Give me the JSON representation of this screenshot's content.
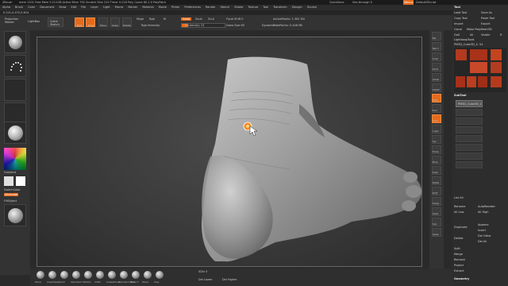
{
  "title_bar": {
    "app": "ZBrush",
    "stats": "mem 1101 Free Mem 5.211GB  Active Mem 792  Scratch Disk 220  Timer 0.018  Poly Count 60.2.0 PolyPaint",
    "quicksave": "QuickSave",
    "see_through": "See-through 0",
    "menus": "Menus",
    "default_zscript": "DefaultZScript"
  },
  "menu_bar": [
    "Alpha",
    "Brush",
    "Color",
    "Document",
    "Draw",
    "Edit",
    "File",
    "Layer",
    "Light",
    "Macro",
    "Marker",
    "Material",
    "Movie",
    "Picker",
    "Preferences",
    "Render",
    "Stencil",
    "Stroke",
    "Texture",
    "Tool",
    "Transform",
    "Zplugin",
    "Zscript"
  ],
  "info_bar": "0.221,0.472,0.614",
  "toolbar": {
    "projection_master": "Projection Master",
    "lightbox": "LightBox",
    "quick_sketch": "Quick Sketch",
    "edit": "Edit",
    "draw": "Draw",
    "move": "Move",
    "scale": "Scale",
    "rotate": "Rotate",
    "mrgb": "Mrgb",
    "rgb": "Rgb",
    "m": "M",
    "rgb_intensity": "Rgb Intensity",
    "zadd": "Zadd",
    "zsub": "Zsub",
    "zcut": "Zcut",
    "z_intensity": "Z Intensity 15",
    "focal_shift": "Focal Shift 0",
    "draw_size": "Draw Size 65",
    "dynamic": "Dynamic",
    "active_points": "ActivePoints: 1.361 Mil",
    "total_points": "TotalPoints: 5.446 Mil"
  },
  "left_shelf": {
    "gradient": "Gradient",
    "switch_color": "SwitchColor",
    "alternate": "Alternate",
    "fill_object": "FillObject"
  },
  "right_shelf": [
    "Bpr",
    "SPix 3",
    "Scroll",
    "Zoom",
    "Actual",
    "AAHalf",
    "Persp",
    "Floor",
    "Local",
    "L.Sym",
    "Xyz",
    "Frame",
    "Move",
    "Scale",
    "Rotate",
    "PolyF",
    "Transp",
    "Ghost",
    "Solo",
    "Xpose"
  ],
  "right_tray": {
    "tool_header": "Tool",
    "load_tool": "Load Tool",
    "save_as": "Save As",
    "copy_tool": "Copy Tool",
    "paste_tool": "Paste Tool",
    "import": "Import",
    "export": "Export",
    "clone": "Clone",
    "make_polymesh": "Make PolyMesh3D",
    "goz": "GoZ",
    "all": "All",
    "visible": "Visible",
    "r": "R",
    "lightbox_tools": "Lightbox▸Tools",
    "current_tool": "PM3D_Cube3D_4. 54",
    "subtool_header": "SubTool",
    "subtool_active": "PM3D_Cube3D_1",
    "list_all": "List All",
    "rename": "Rename",
    "autoreorder": "AutoReorder",
    "all_low": "All Low",
    "all_high": "All High",
    "duplicate": "Duplicate",
    "append": "Append",
    "insert": "Insert",
    "delete": "Delete",
    "del_other": "Del Other",
    "del_all": "Del All",
    "split": "Split",
    "merge": "Merge",
    "remesh": "Remesh",
    "project": "Project",
    "extract": "Extract",
    "geometry": "Geometry"
  },
  "bottom_shelf": {
    "brushes": [
      "Move",
      "ClayTubes",
      "Pinch",
      "Standard",
      "hPolish",
      "Inflat",
      "SnakeHook",
      "Standard Mod",
      "Move T",
      "Move",
      "Clay"
    ],
    "sdiv": "SDiv 5",
    "del_lower": "Del Lower",
    "del_higher": "Del Higher"
  },
  "colors": {
    "accent": "#e46b1e",
    "viewport_bg": "#3a3a3a"
  }
}
